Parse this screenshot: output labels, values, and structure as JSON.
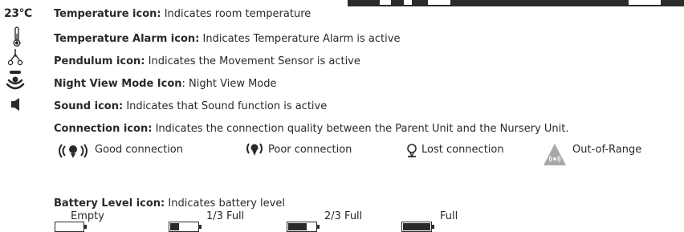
{
  "temperature_readout": "23°C",
  "items": [
    {
      "label": "Temperature icon:",
      "desc": " Indicates room temperature"
    },
    {
      "label": "Temperature Alarm icon:",
      "desc": " Indicates Temperature Alarm is active"
    },
    {
      "label": "Pendulum icon:",
      "desc": " Indicates the Movement Sensor is active"
    },
    {
      "label": "Night View Mode Icon",
      "desc": ": Night View Mode"
    },
    {
      "label": "Sound icon:",
      "desc": " Indicates that Sound function is active"
    },
    {
      "label": "Connection icon:",
      "desc": " Indicates the connection quality between the Parent Unit and the Nursery Unit."
    }
  ],
  "connection_states": [
    "Good connection",
    "Poor connection",
    "Lost connection",
    "Out-of-Range"
  ],
  "battery": {
    "label": "Battery Level icon:",
    "desc": " Indicates battery level",
    "levels": [
      {
        "label": "Empty",
        "fill": 0
      },
      {
        "label": "1/3 Full",
        "fill": 0.33
      },
      {
        "label": "2/3 Full",
        "fill": 0.67
      },
      {
        "label": "Full",
        "fill": 1
      }
    ]
  }
}
